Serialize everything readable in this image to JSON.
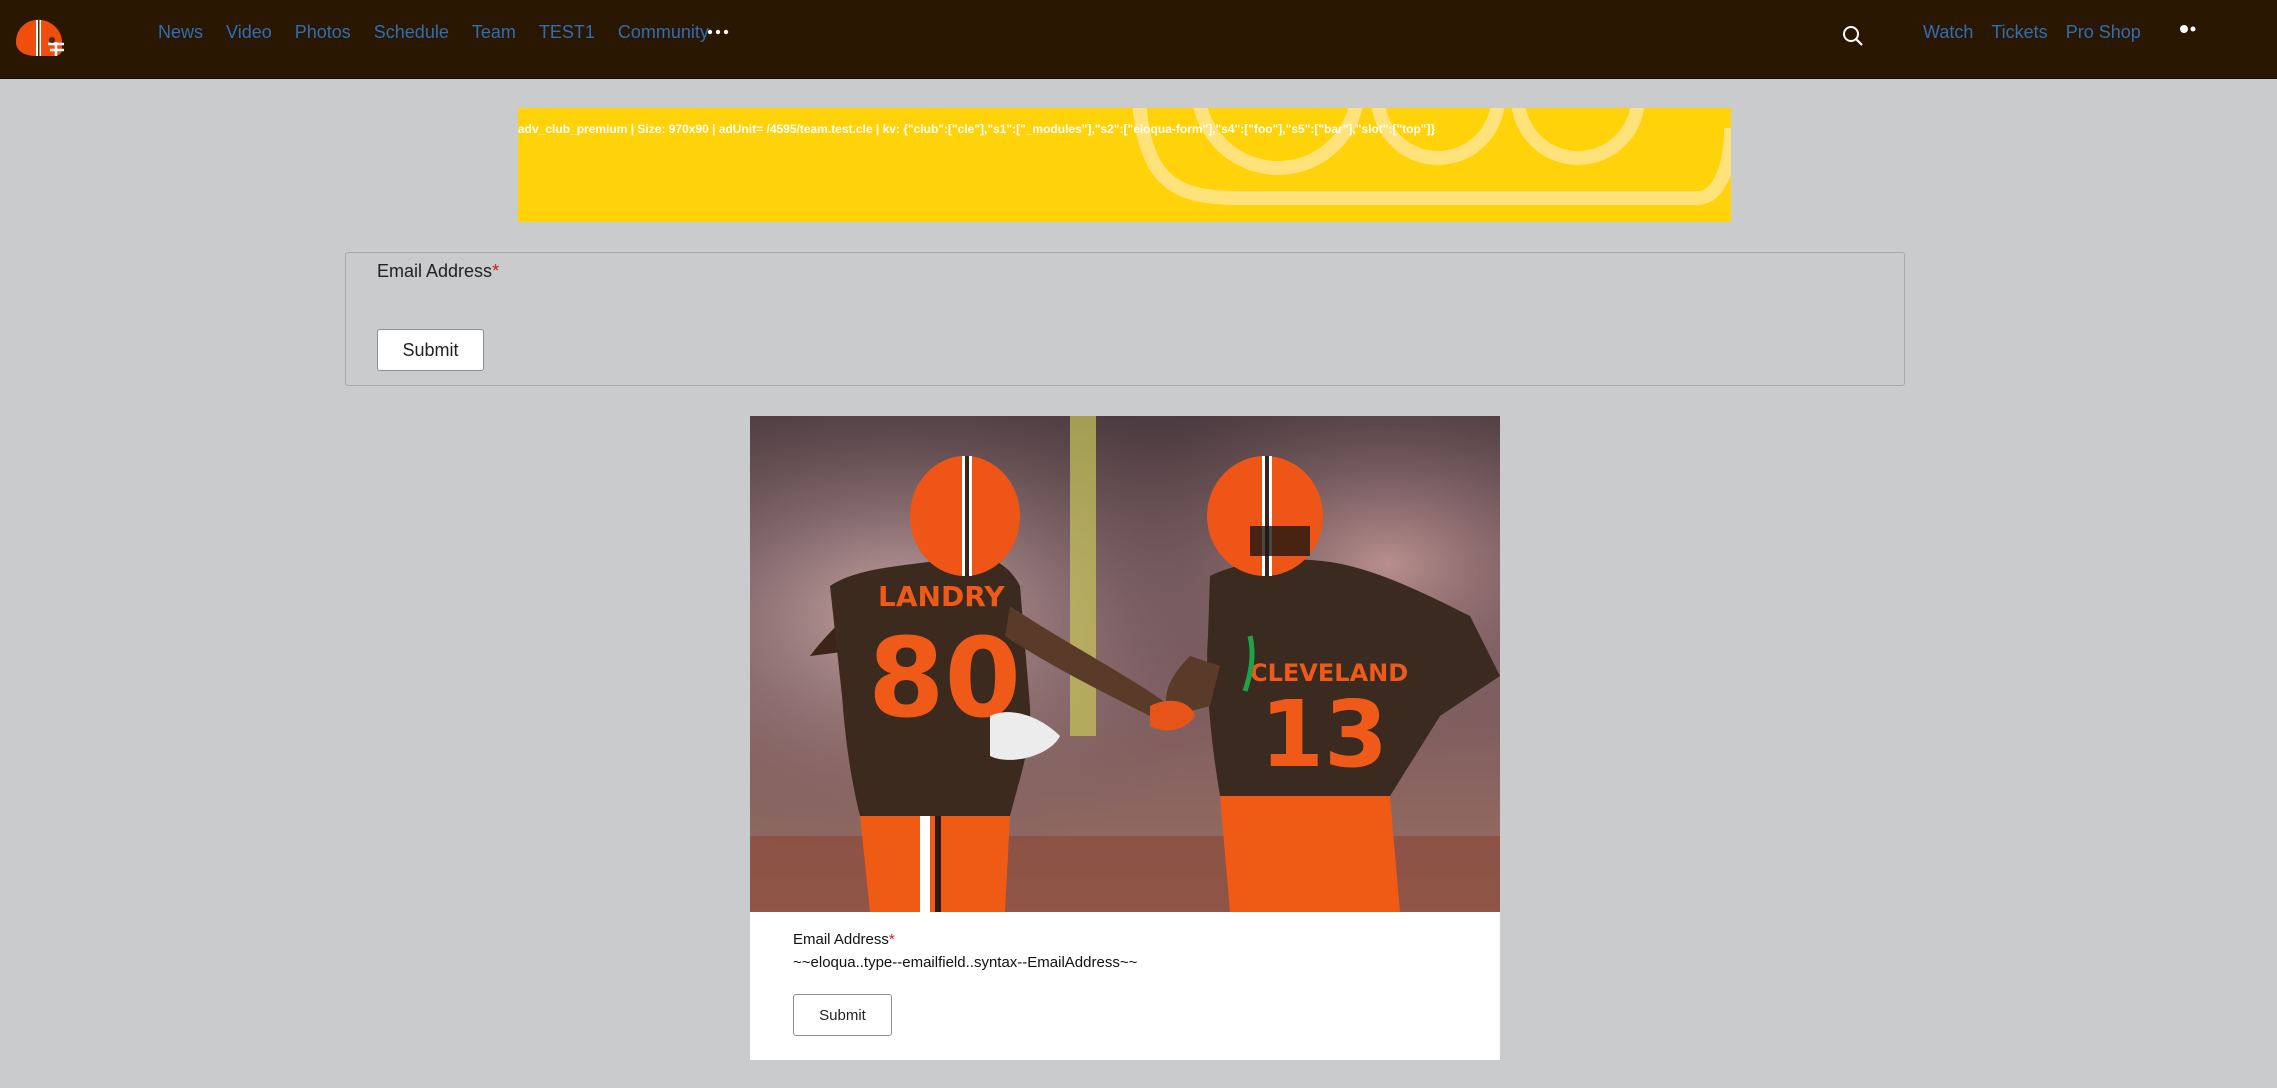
{
  "nav": {
    "logo_icon": "helmet-logo-icon",
    "links": [
      "News",
      "Video",
      "Photos",
      "Schedule",
      "Team",
      "TEST1",
      "Community"
    ],
    "more_icon": "more-dots-icon",
    "search_icon": "search-icon",
    "utility_links": [
      "Watch",
      "Tickets",
      "Pro Shop"
    ],
    "profile_icon": "profile-dots-icon"
  },
  "ad": {
    "text": "adv_club_premium | Size: 970x90 | adUnit= /4595/team.test.cle | kv: {\"club\":[\"cle\"],\"s1\":[\"_modules\"],\"s2\":[\"eloqua-form\"],\"s4\":[\"foo\"],\"s5\":[\"bar\"],\"slot\":[\"top\"]}"
  },
  "form": {
    "email_label": "Email Address",
    "required_mark": "*",
    "submit_label": "Submit"
  },
  "card": {
    "image_alt": "football-players-high-five-photo",
    "email_label": "Email Address",
    "required_mark": "*",
    "email_value": "~~eloqua..type--emailfield..syntax--EmailAddress~~",
    "submit_label": "Submit"
  },
  "colors": {
    "nav_bg": "#2a1702",
    "link": "#2f6db5",
    "ad_bg": "#ffd20a",
    "page_bg": "#cacbcd",
    "required": "#d7141a"
  }
}
